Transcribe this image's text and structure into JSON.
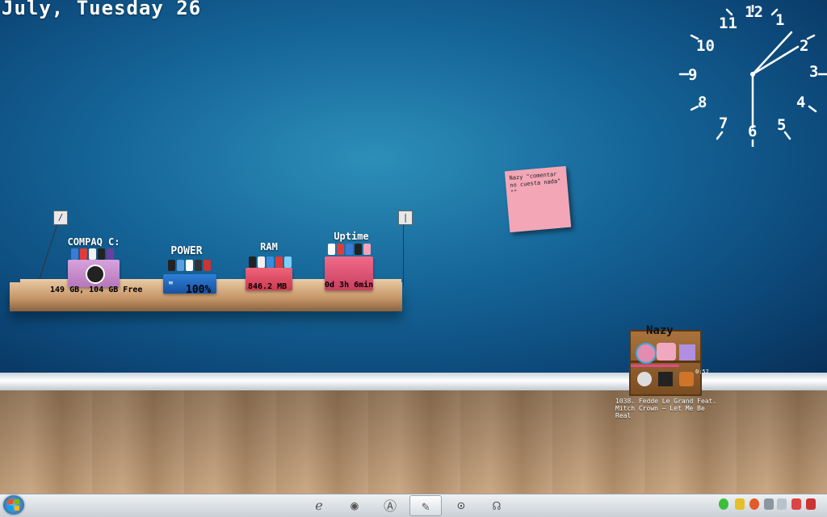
{
  "desktop": {
    "date": "July, Tuesday 26"
  },
  "clock": {
    "numbers": [
      "12",
      "1",
      "2",
      "3",
      "4",
      "5",
      "6",
      "7",
      "8",
      "9",
      "10",
      "11"
    ]
  },
  "shelf": {
    "widgets": [
      {
        "label": "COMPAQ C:",
        "value": "149 GB, 104 GB Free",
        "color": "#c98bcf"
      },
      {
        "label": "POWER",
        "value": "100%",
        "color": "#1b5fb0"
      },
      {
        "label": "RAM",
        "value": "846.2 MB",
        "color": "#e24a62"
      },
      {
        "label": "Uptime",
        "value": "0d 3h 6min",
        "color": "#e55478"
      }
    ]
  },
  "note": {
    "text": "Nazy \"comentar no cuesta nada\" \"\""
  },
  "music": {
    "title": "Nazy",
    "time": "0:52",
    "track": "1038. Fedde Le Grand Feat. Mitch Crown – Let Me Be Real"
  },
  "taskbar": {
    "icons": [
      "ie-icon",
      "chrome-icon",
      "app-a-icon",
      "tools-icon",
      "media-player-icon",
      "headphones-icon"
    ]
  }
}
